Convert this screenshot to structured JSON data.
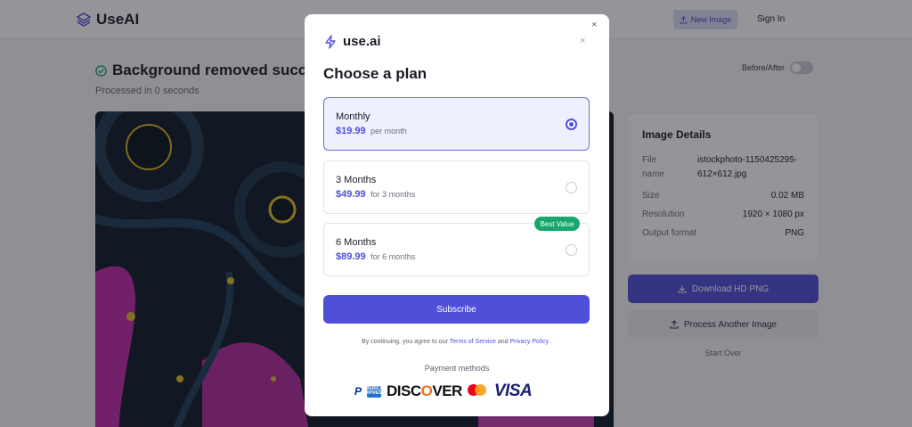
{
  "header": {
    "brand": "UseAI",
    "new_image": "New Image",
    "sign_in": "Sign In"
  },
  "main": {
    "status_title": "Background removed successfully",
    "processed": "Processed in 0 seconds",
    "before_after": "Before/After"
  },
  "details": {
    "title": "Image Details",
    "rows": [
      {
        "key": "File name",
        "value": "istockphoto-1150425295-612×612.jpg"
      },
      {
        "key": "Size",
        "value": "0.02 MB"
      },
      {
        "key": "Resolution",
        "value": "1920 × 1080 px"
      },
      {
        "key": "Output format",
        "value": "PNG"
      }
    ],
    "download": "Download HD PNG",
    "process_another": "Process Another Image",
    "start_over": "Start Over"
  },
  "modal": {
    "logo": "use.ai",
    "close": "×",
    "title": "Choose a plan",
    "plans": [
      {
        "name": "Monthly",
        "price": "$19.99",
        "period": "per month",
        "selected": true
      },
      {
        "name": "3 Months",
        "price": "$49.99",
        "period": "for 3 months",
        "selected": false
      },
      {
        "name": "6 Months",
        "price": "$89.99",
        "period": "for 6 months",
        "selected": false,
        "badge": "Best Value"
      }
    ],
    "subscribe": "Subscribe",
    "terms_prefix": "By continuing, you agree to our",
    "terms_of_service": "Terms of Service",
    "terms_and": "and",
    "privacy_policy": "Privacy Policy",
    "terms_suffix": ".",
    "payment_label": "Payment methods",
    "payment_logos": {
      "paypal": "P",
      "amex": "AMERICAN EXPRESS",
      "discover_a": "DISC",
      "discover_o": "O",
      "discover_b": "VER",
      "visa": "VISA"
    }
  },
  "colors": {
    "accent": "#4f4fd8",
    "badge": "#18a66c"
  }
}
